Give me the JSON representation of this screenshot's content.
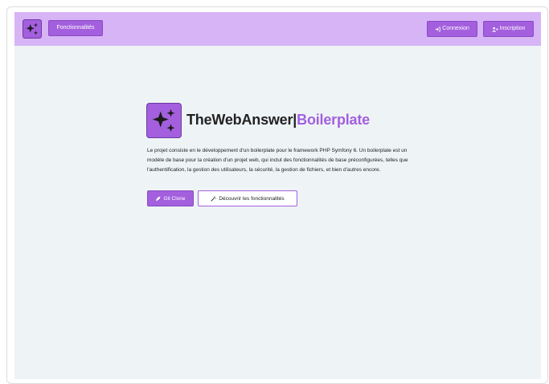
{
  "navbar": {
    "features_label": "Fonctionnalités",
    "login_label": "Connexion",
    "signup_label": "Inscription"
  },
  "hero": {
    "title_main": "TheWebAnswer",
    "title_separator": "|",
    "title_accent": "Boilerplate",
    "description": "Le projet consiste en le développement d'un boilerplate pour le framework PHP Symfony 6. Un boilerplate est un modèle de base pour la création d'un projet web, qui inclut des fonctionnalités de base préconfigurées, telles que l'authentification, la gestion des utilisateurs, la sécurité, la gestion de fichiers, et bien d'autres encore.",
    "clone_label": "Git Clone",
    "discover_label": "Découvrir les fonctionnalités"
  },
  "colors": {
    "accent": "#a35fdd",
    "navbar_bg": "#d7b4f6",
    "page_bg": "#eef4f6"
  },
  "icons": {
    "logo": "sparkles-icon",
    "login": "sign-in-icon",
    "signup": "user-plus-icon",
    "clone": "rocket-icon",
    "discover": "magic-wand-icon"
  }
}
